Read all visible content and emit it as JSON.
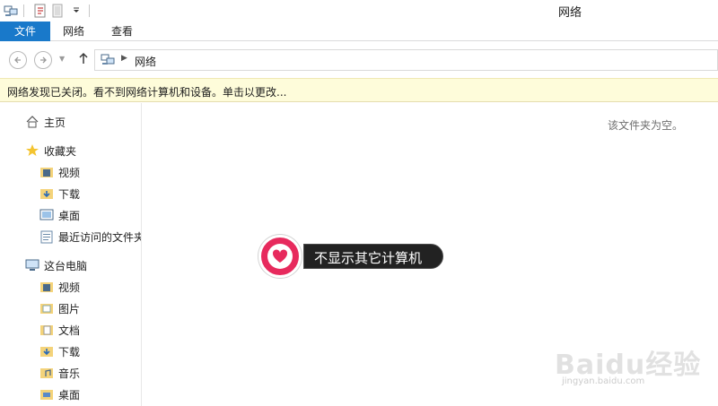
{
  "window": {
    "title": "网络"
  },
  "ribbon": {
    "tabs": [
      "文件",
      "网络",
      "查看"
    ]
  },
  "address": {
    "path": "网络"
  },
  "infobar": {
    "text": "网络发现已关闭。看不到网络计算机和设备。单击以更改..."
  },
  "nav": {
    "home": "主页",
    "favorites": {
      "label": "收藏夹",
      "items": [
        "视频",
        "下载",
        "桌面",
        "最近访问的文件夹"
      ]
    },
    "this_pc": {
      "label": "这台电脑",
      "items": [
        "视频",
        "图片",
        "文档",
        "下载",
        "音乐",
        "桌面"
      ]
    }
  },
  "content": {
    "empty_message": "该文件夹为空。"
  },
  "callout": {
    "text": "不显示其它计算机",
    "icon": "heart-icon",
    "accent": "#e72a5d"
  },
  "watermark": {
    "brand": "Baidu经验",
    "url": "jingyan.baidu.com"
  },
  "colors": {
    "file_tab": "#1979ca",
    "infobar_bg": "#fefcda"
  }
}
